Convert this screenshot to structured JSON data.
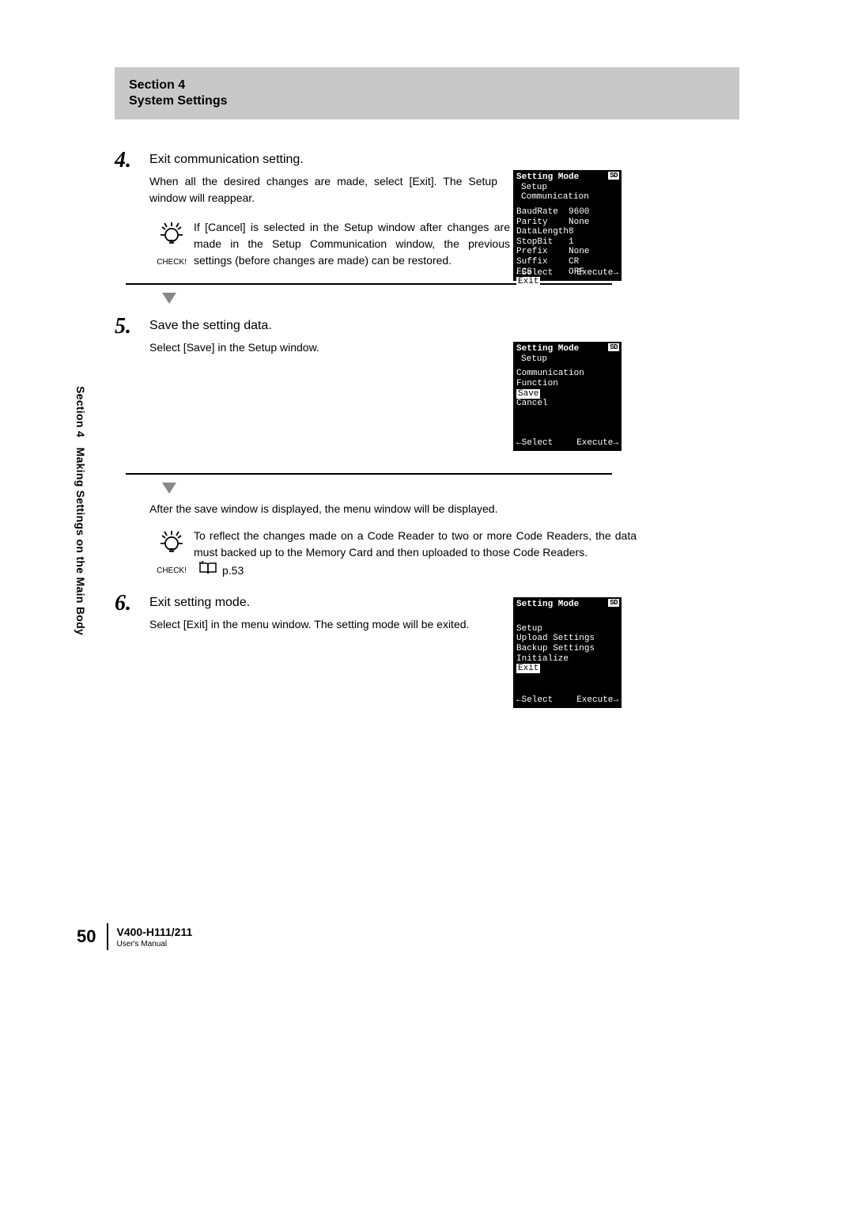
{
  "section": {
    "line1": "Section 4",
    "line2": "System Settings"
  },
  "sideTab": {
    "section": "Section 4",
    "title": "Making Settings on the Main Body"
  },
  "steps": {
    "s4": {
      "num": "4",
      "title": "Exit communication setting.",
      "desc": "When all the desired changes are made, select [Exit]. The Setup window will reappear.",
      "check": "If [Cancel] is selected in the Setup window after changes are made in the Setup Communication window, the previous settings (before changes are made) can be restored."
    },
    "s5": {
      "num": "5",
      "title": "Save the setting data.",
      "desc": "Select [Save] in the Setup window.",
      "afterSave": "After the save window is displayed, the menu window will be displayed.",
      "checkText": "To reflect the changes made on a Code Reader to two or more Code Readers, the data must backed up to the Memory Card and then uploaded to those Code Readers.",
      "pageRef": "p.53"
    },
    "s6": {
      "num": "6",
      "title": "Exit setting mode.",
      "desc": "Select [Exit] in the menu window. The setting mode will be exited."
    }
  },
  "checkLabel": "CHECK!",
  "device1": {
    "header": "Setting Mode",
    "sub": "Setup Communication",
    "sd": "SD",
    "rows": [
      {
        "k": "BaudRate",
        "v": "9600"
      },
      {
        "k": "Parity",
        "v": "None"
      },
      {
        "k": "DataLength",
        "v": "8"
      },
      {
        "k": "StopBit",
        "v": "1"
      },
      {
        "k": "Prefix",
        "v": "None"
      },
      {
        "k": "Suffix",
        "v": "CR"
      },
      {
        "k": "FCS",
        "v": "OFF"
      }
    ],
    "exit": "Exit",
    "selectLabel": "←Select",
    "executeLabel": "Execute→"
  },
  "device2": {
    "header": "Setting Mode",
    "sub": "Setup",
    "sd": "SD",
    "items": [
      "Communication",
      "Function"
    ],
    "saveLabel": "Save",
    "cancelLabel": "Cancel",
    "selectLabel": "←Select",
    "executeLabel": "Execute→"
  },
  "device3": {
    "header": "Setting Mode",
    "sd": "SD",
    "items": [
      "Setup",
      "Upload Settings",
      "Backup Settings",
      "Initialize"
    ],
    "exit": "Exit",
    "selectLabel": "←Select",
    "executeLabel": "Execute→"
  },
  "footer": {
    "pageNumber": "50",
    "model": "V400-H111/211",
    "manual": "User's Manual"
  }
}
